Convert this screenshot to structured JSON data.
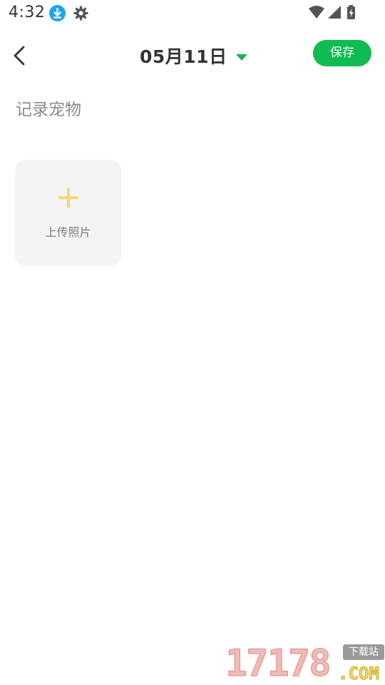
{
  "status_bar": {
    "time": "4:32",
    "icons": [
      "download-icon",
      "gear-icon",
      "wifi-icon",
      "signal-icon",
      "battery-charging-icon"
    ]
  },
  "header": {
    "back_icon": "chevron-left-icon",
    "date": "05月11日",
    "date_caret_icon": "caret-down-icon",
    "save_label": "保存"
  },
  "form": {
    "record_placeholder": "记录宠物",
    "record_value": ""
  },
  "upload": {
    "icon": "plus-icon",
    "label": "上传照片"
  },
  "watermark": {
    "digits": "17178",
    "badge": "下载站",
    "domain": ".COM"
  },
  "colors": {
    "accent_green": "#0fbc51",
    "caret_green": "#1bb24e",
    "plus_yellow": "#f5d76e",
    "tile_bg": "#f4f4f4",
    "download_blue": "#1aa4ee"
  }
}
